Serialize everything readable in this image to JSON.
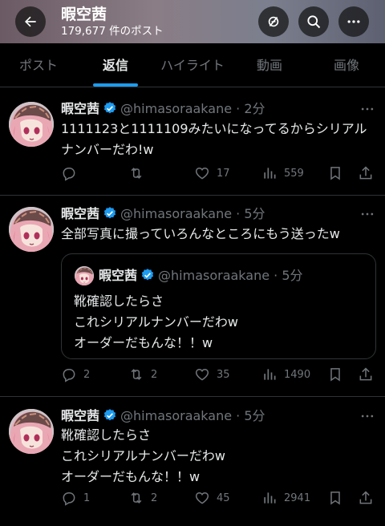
{
  "header": {
    "title": "暇空茜",
    "post_count": "179,677 件のポスト"
  },
  "tabs": [
    {
      "label": "ポスト"
    },
    {
      "label": "返信"
    },
    {
      "label": "ハイライト"
    },
    {
      "label": "動画"
    },
    {
      "label": "画像"
    }
  ],
  "posts": [
    {
      "name": "暇空茜",
      "handle": "@himasoraakane · 2分",
      "text1": "1111123と1111109みたいになってるからシリアル",
      "text2": "ナンバーだわ!w",
      "reply": "",
      "repost": "",
      "like": "17",
      "views": "559"
    },
    {
      "name": "暇空茜",
      "handle": "@himasoraakane · 5分",
      "text1": "全部写真に撮っていろんなところにもう送ったw",
      "quote": {
        "name": "暇空茜",
        "handle": "@himasoraakane · 5分",
        "line1": "靴確認したらさ",
        "line2": "これシリアルナンバーだわw",
        "line3": "オーダーだもんな！！w"
      },
      "reply": "2",
      "repost": "2",
      "like": "35",
      "views": "1490"
    },
    {
      "name": "暇空茜",
      "handle": "@himasoraakane · 5分",
      "line1": "靴確認したらさ",
      "line2": "これシリアルナンバーだわw",
      "line3": "オーダーだもんな！！w",
      "reply": "1",
      "repost": "2",
      "like": "45",
      "views": "2941"
    }
  ]
}
